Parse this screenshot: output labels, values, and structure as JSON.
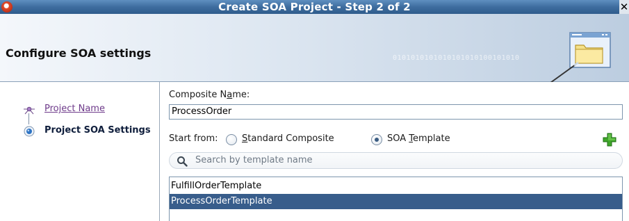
{
  "window": {
    "title": "Create SOA Project - Step 2 of 2"
  },
  "header": {
    "title": "Configure SOA settings",
    "binary_text": "0101010101010101010100101010"
  },
  "nav": {
    "items": [
      {
        "label": "Project Name",
        "state": "link"
      },
      {
        "label": "Project SOA Settings",
        "state": "current"
      }
    ]
  },
  "form": {
    "composite_name_label_pre": "Composite N",
    "composite_name_label_mnemonic": "a",
    "composite_name_label_post": "me:",
    "composite_name_value": "ProcessOrder",
    "start_from_label": "Start from:",
    "radio_standard_mnemonic": "S",
    "radio_standard_rest": "tandard Composite",
    "radio_template_pre": "SOA ",
    "radio_template_mnemonic": "T",
    "radio_template_post": "emplate",
    "selected_option": "SOA Template",
    "search_placeholder": "Search by template name"
  },
  "templates": {
    "items": [
      "FulfillOrderTemplate",
      "ProcessOrderTemplate"
    ],
    "selected": "ProcessOrderTemplate"
  },
  "icons": {
    "app": "oracle-app-icon",
    "close": "close-icon",
    "add": "add-icon",
    "search": "search-icon",
    "header": "folder-window-icon"
  }
}
